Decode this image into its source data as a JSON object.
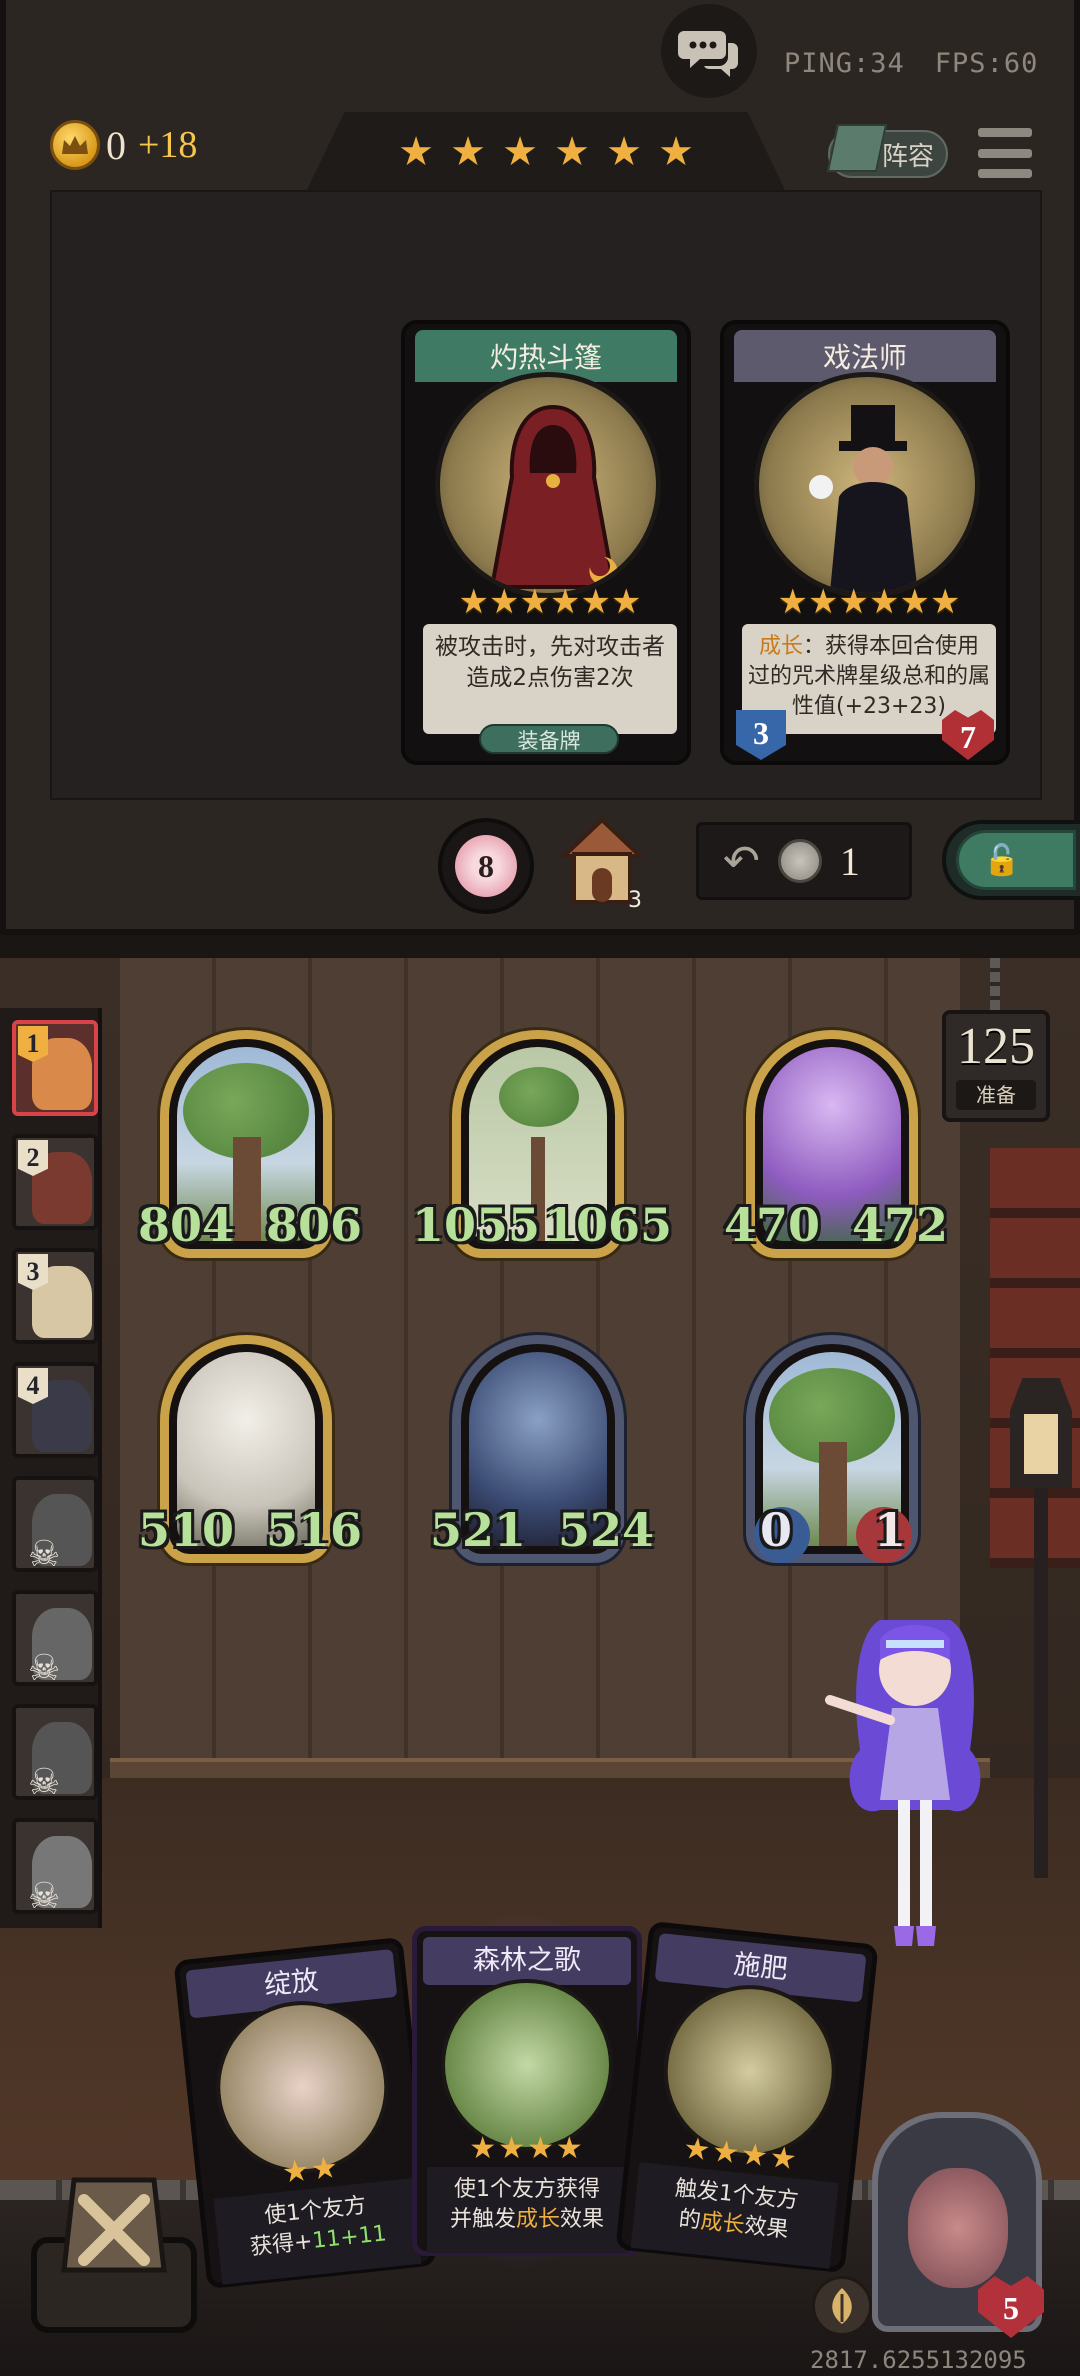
{
  "network": {
    "ping": "PING:34",
    "fps": "FPS:60"
  },
  "gold": {
    "value": "0",
    "income": "+18"
  },
  "shop_stars": [
    "★",
    "★",
    "★",
    "★",
    "★",
    "★"
  ],
  "lineup_button": {
    "label": "阵容"
  },
  "shop_cards": [
    {
      "title": "灼热斗篷",
      "stars": "★★★★★★",
      "description": "被攻击时，先对攻击者造成2点伤害2次",
      "tag": "装备牌",
      "banner_color": "#3f7a64"
    },
    {
      "title": "戏法师",
      "stars": "★★★★★★",
      "desc_keyword": "成长",
      "description": "：获得本回合使用过的咒术牌星级总和的属性值(+23+23)",
      "attack": "3",
      "health": "7",
      "banner_color": "#5e5a6e"
    }
  ],
  "shop_controls": {
    "flower_count": "8",
    "house_count": "3",
    "refresh_cost": "1"
  },
  "round": {
    "number": "125",
    "label": "准备"
  },
  "queue": [
    {
      "order": "1",
      "active": true,
      "dead": false,
      "color": "#d98a4a"
    },
    {
      "order": "2",
      "active": false,
      "dead": false,
      "color": "#7a3a30"
    },
    {
      "order": "3",
      "active": false,
      "dead": false,
      "color": "#d8c7a5"
    },
    {
      "order": "4",
      "active": false,
      "dead": false,
      "color": "#3a3a48"
    },
    {
      "order": "",
      "active": false,
      "dead": true,
      "color": "#555"
    },
    {
      "order": "",
      "active": false,
      "dead": true,
      "color": "#666"
    },
    {
      "order": "",
      "active": false,
      "dead": true,
      "color": "#555"
    },
    {
      "order": "",
      "active": false,
      "dead": true,
      "color": "#777"
    }
  ],
  "board_units": [
    {
      "name": "tree-1",
      "attack": "804",
      "health": "806",
      "frame": "gold"
    },
    {
      "name": "tree-2",
      "attack": "1055",
      "health": "1065",
      "frame": "gold"
    },
    {
      "name": "fairy",
      "attack": "470",
      "health": "472",
      "frame": "gold"
    },
    {
      "name": "lady-white",
      "attack": "510",
      "health": "516",
      "frame": "gold"
    },
    {
      "name": "dark-elf",
      "attack": "521",
      "health": "524",
      "frame": "blue"
    },
    {
      "name": "tree-3",
      "attack": "0",
      "health": "1",
      "frame": "blue"
    }
  ],
  "hand_cards": [
    {
      "title": "绽放",
      "stars": "★★",
      "line1": "使1个友方",
      "line2a": "获得+",
      "line2b": "11+11"
    },
    {
      "title": "森林之歌",
      "stars": "★★★★",
      "line1": "使1个友方获得",
      "line2a": "并触发",
      "line2b": "成长",
      "line2c": "效果"
    },
    {
      "title": "施肥",
      "stars": "★★★★",
      "line1": "触发1个友方",
      "line2a": "的",
      "line2b": "成长",
      "line2c": "效果"
    }
  ],
  "player": {
    "health": "5"
  },
  "seed": "2817.6255132095"
}
